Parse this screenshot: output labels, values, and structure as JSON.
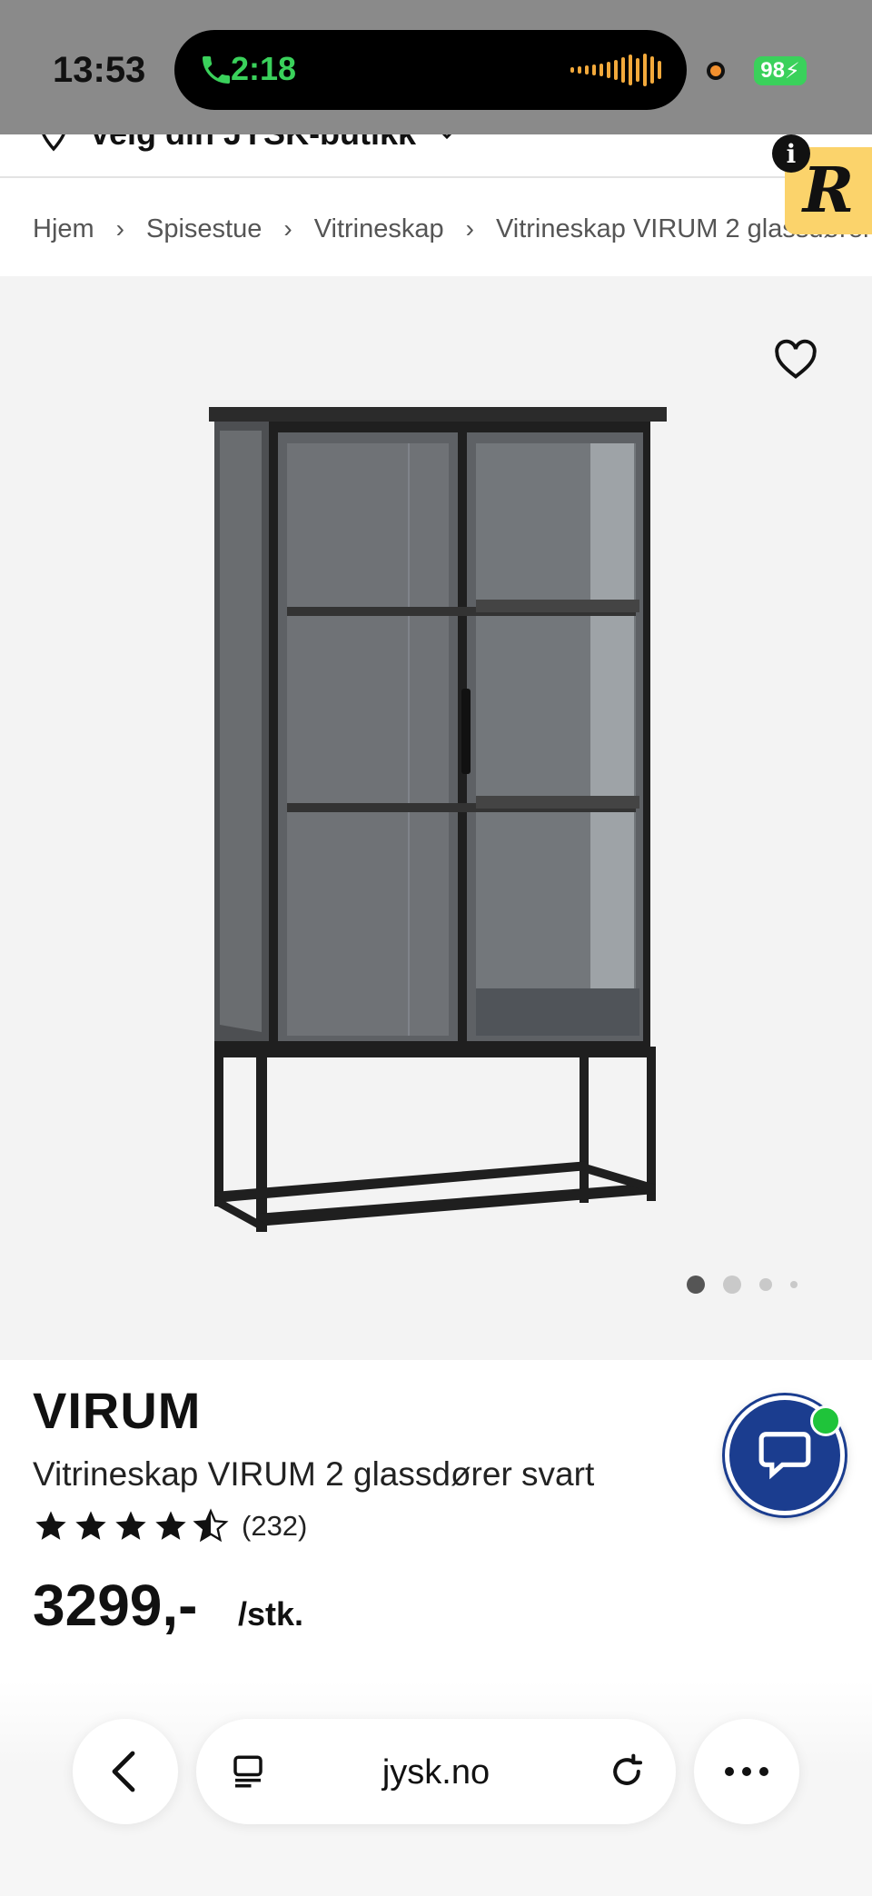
{
  "status_bar": {
    "time": "13:53",
    "call_duration": "2:18",
    "battery": "98"
  },
  "store_bar": {
    "label": "Velg din JYSK-butikk"
  },
  "extension": {
    "badge_letter": "R",
    "info_letter": "i"
  },
  "breadcrumb": [
    "Hjem",
    "Spisestue",
    "Vitrineskap",
    "Vitrineskap VIRUM 2 glassdører"
  ],
  "product": {
    "brand": "VIRUM",
    "name": "Vitrineskap VIRUM 2 glassdører svart",
    "rating": 4.5,
    "rating_count": "(232)",
    "price": "3299,-",
    "unit": "/stk."
  },
  "gallery": {
    "image_count": 4,
    "active_index": 0
  },
  "browser": {
    "url": "jysk.no"
  },
  "colors": {
    "status_bar_bg": "#8a8a8a",
    "call_green": "#3ad15b",
    "chat_blue": "#1b3d8f",
    "online_green": "#1fc43a",
    "badge_yellow": "#fbd36b",
    "gallery_bg": "#f3f3f3"
  },
  "icons": {
    "call": "phone-icon",
    "store": "location-pin-icon",
    "favorite": "heart-icon",
    "chat": "chat-bubble-icon",
    "back": "chevron-left-icon",
    "reader": "reader-mode-icon",
    "reload": "reload-icon",
    "more": "more-dots-icon"
  }
}
